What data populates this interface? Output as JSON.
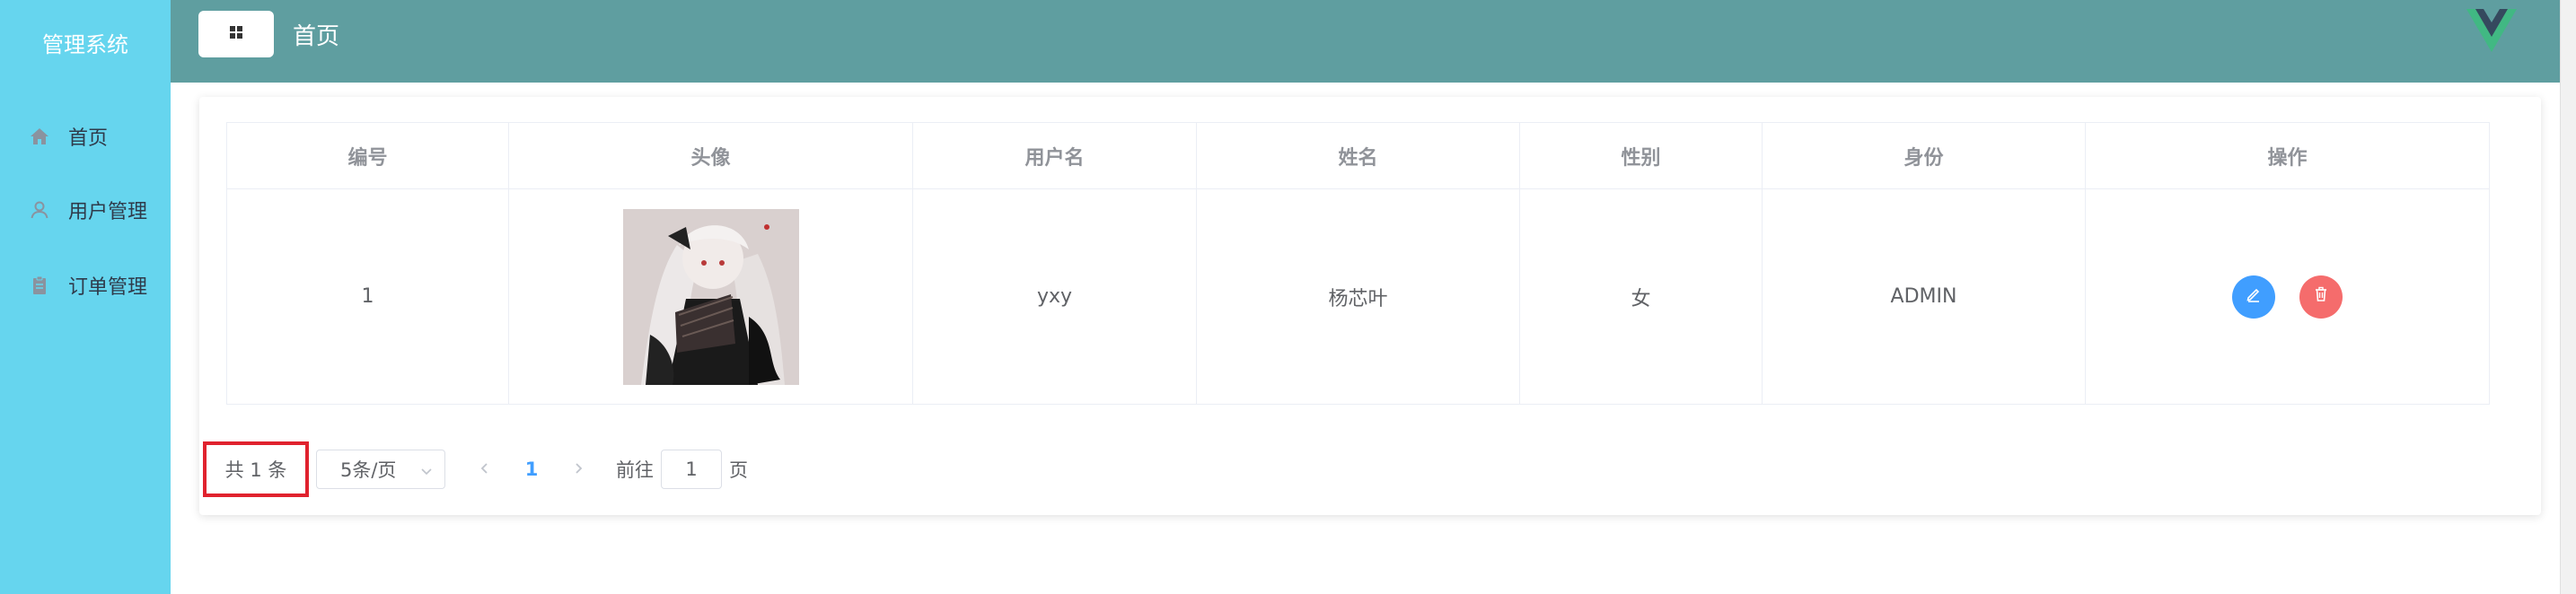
{
  "sidebar": {
    "title": "管理系统",
    "items": [
      {
        "label": "首页",
        "icon": "home-icon"
      },
      {
        "label": "用户管理",
        "icon": "user-icon"
      },
      {
        "label": "订单管理",
        "icon": "clipboard-icon"
      }
    ]
  },
  "header": {
    "breadcrumb": "首页",
    "toggle_icon": "grid-icon",
    "logo_icon": "vue-logo-icon"
  },
  "table": {
    "columns": [
      "编号",
      "头像",
      "用户名",
      "姓名",
      "性别",
      "身份",
      "操作"
    ],
    "rows": [
      {
        "id": "1",
        "avatar": "avatar-image",
        "username": "yxy",
        "name": "杨芯叶",
        "gender": "女",
        "role": "ADMIN"
      }
    ]
  },
  "pagination": {
    "total": "共 1 条",
    "page_size": "5条/页",
    "current_page": "1",
    "jump_label": "前往",
    "jump_value": "1",
    "suffix": "页"
  },
  "colors": {
    "sidebar": "#66d5ee",
    "header": "#5f9ea0",
    "primary": "#409eff",
    "danger": "#f56c6c",
    "highlight": "#e0222e"
  }
}
